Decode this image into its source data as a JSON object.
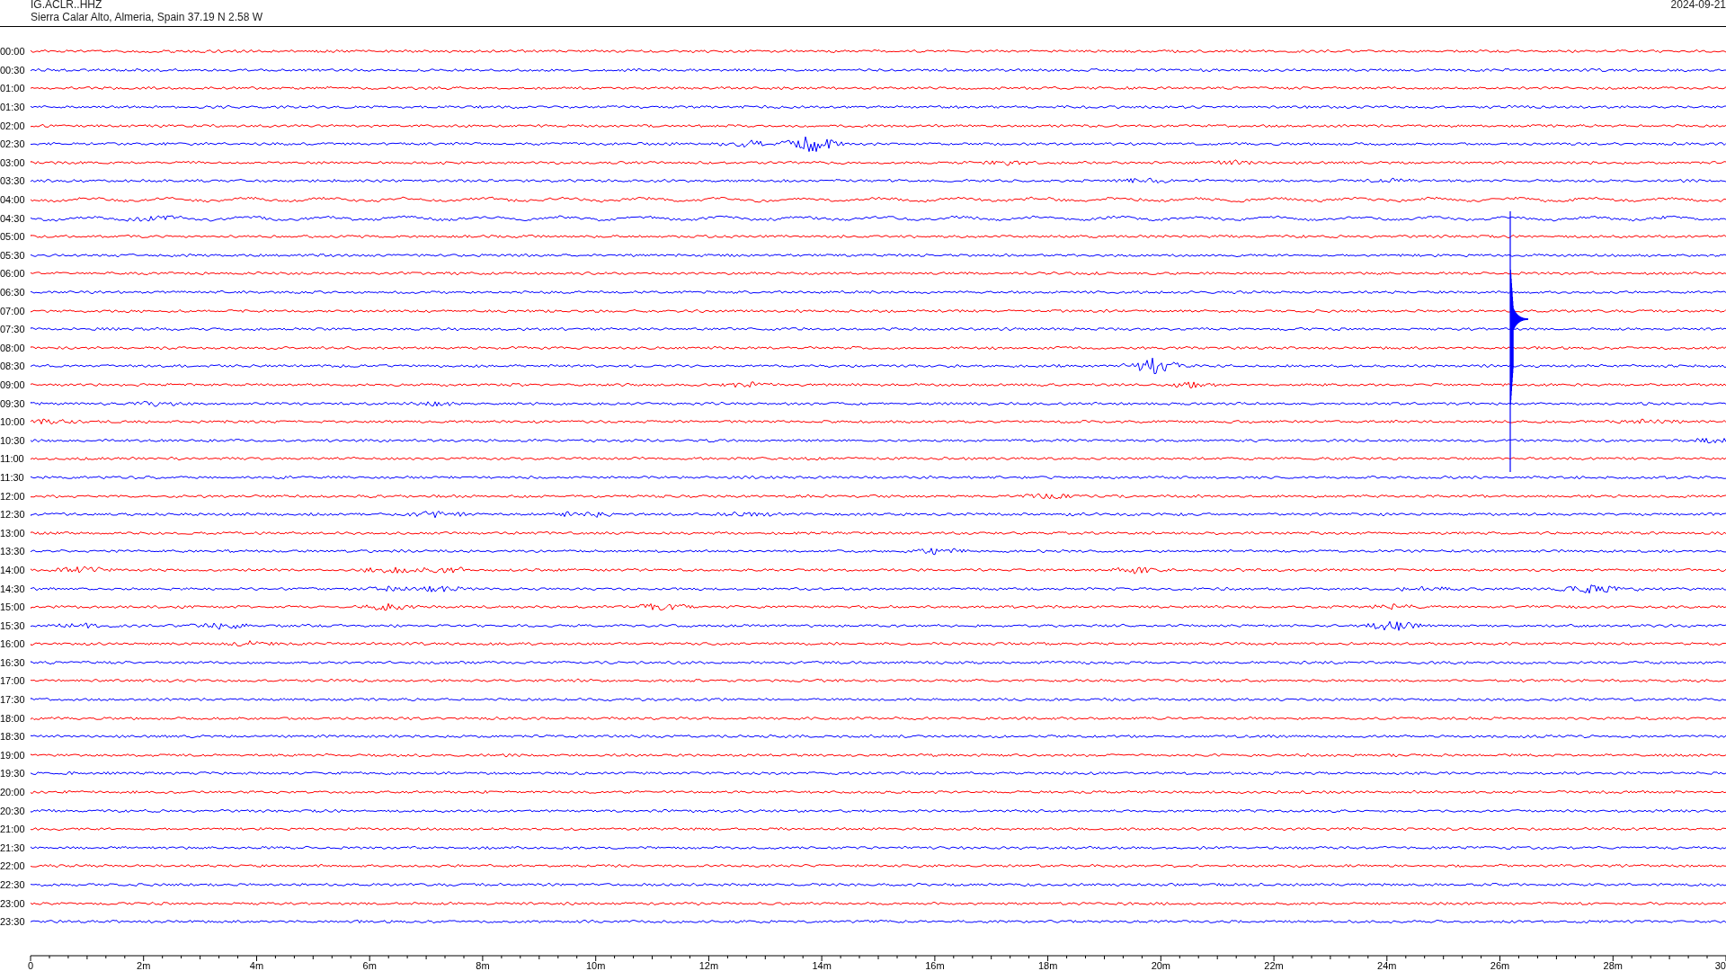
{
  "header": {
    "station": "IG.ACLR..HHZ",
    "location": "Sierra Calar Alto, Almeria, Spain  37.19 N 2.58 W",
    "date": "2024-09-21"
  },
  "rows": [
    {
      "time": "00:00",
      "color": "#ff0000"
    },
    {
      "time": "00:30",
      "color": "#0000ff"
    },
    {
      "time": "01:00",
      "color": "#ff0000"
    },
    {
      "time": "01:30",
      "color": "#0000ff"
    },
    {
      "time": "02:00",
      "color": "#ff0000"
    },
    {
      "time": "02:30",
      "color": "#0000ff"
    },
    {
      "time": "03:00",
      "color": "#ff0000"
    },
    {
      "time": "03:30",
      "color": "#0000ff"
    },
    {
      "time": "04:00",
      "color": "#ff0000"
    },
    {
      "time": "04:30",
      "color": "#0000ff"
    },
    {
      "time": "05:00",
      "color": "#ff0000"
    },
    {
      "time": "05:30",
      "color": "#0000ff"
    },
    {
      "time": "06:00",
      "color": "#ff0000"
    },
    {
      "time": "06:30",
      "color": "#0000ff"
    },
    {
      "time": "07:00",
      "color": "#ff0000"
    },
    {
      "time": "07:30",
      "color": "#0000ff"
    },
    {
      "time": "08:00",
      "color": "#ff0000"
    },
    {
      "time": "08:30",
      "color": "#0000ff"
    },
    {
      "time": "09:00",
      "color": "#ff0000"
    },
    {
      "time": "09:30",
      "color": "#0000ff"
    },
    {
      "time": "10:00",
      "color": "#ff0000"
    },
    {
      "time": "10:30",
      "color": "#0000ff"
    },
    {
      "time": "11:00",
      "color": "#ff0000"
    },
    {
      "time": "11:30",
      "color": "#0000ff"
    },
    {
      "time": "12:00",
      "color": "#ff0000"
    },
    {
      "time": "12:30",
      "color": "#0000ff"
    },
    {
      "time": "13:00",
      "color": "#ff0000"
    },
    {
      "time": "13:30",
      "color": "#0000ff"
    },
    {
      "time": "14:00",
      "color": "#ff0000"
    },
    {
      "time": "14:30",
      "color": "#0000ff"
    },
    {
      "time": "15:00",
      "color": "#ff0000"
    },
    {
      "time": "15:30",
      "color": "#0000ff"
    },
    {
      "time": "16:00",
      "color": "#ff0000"
    },
    {
      "time": "16:30",
      "color": "#0000ff"
    },
    {
      "time": "17:00",
      "color": "#ff0000"
    },
    {
      "time": "17:30",
      "color": "#0000ff"
    },
    {
      "time": "18:00",
      "color": "#ff0000"
    },
    {
      "time": "18:30",
      "color": "#0000ff"
    },
    {
      "time": "19:00",
      "color": "#ff0000"
    },
    {
      "time": "19:30",
      "color": "#0000ff"
    },
    {
      "time": "20:00",
      "color": "#ff0000"
    },
    {
      "time": "20:30",
      "color": "#0000ff"
    },
    {
      "time": "21:00",
      "color": "#ff0000"
    },
    {
      "time": "21:30",
      "color": "#0000ff"
    },
    {
      "time": "22:00",
      "color": "#ff0000"
    },
    {
      "time": "22:30",
      "color": "#0000ff"
    },
    {
      "time": "23:00",
      "color": "#ff0000"
    },
    {
      "time": "23:30",
      "color": "#0000ff"
    }
  ],
  "axis": {
    "labels": [
      "0",
      "2m",
      "4m",
      "6m",
      "8m",
      "10m",
      "12m",
      "14m",
      "16m",
      "18m",
      "20m",
      "22m",
      "24m",
      "26m",
      "28m",
      "30"
    ]
  }
}
